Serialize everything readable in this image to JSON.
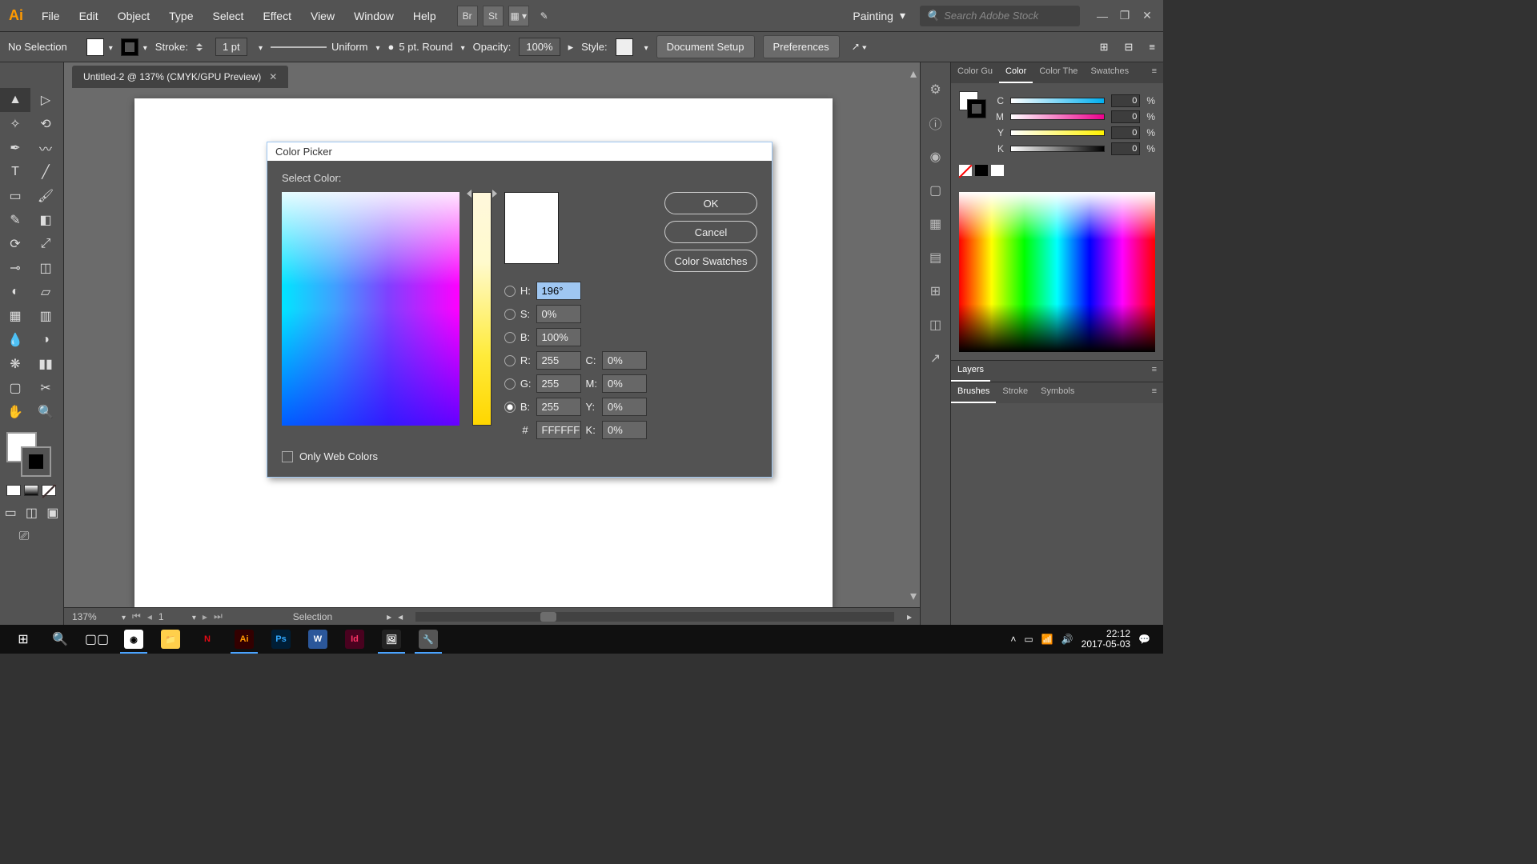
{
  "menu": {
    "items": [
      "File",
      "Edit",
      "Object",
      "Type",
      "Select",
      "Effect",
      "View",
      "Window",
      "Help"
    ],
    "logo": "Ai",
    "bridge": "Br",
    "stock": "St"
  },
  "workspace": {
    "name": "Painting",
    "stock_placeholder": "Search Adobe Stock"
  },
  "options": {
    "status": "No Selection",
    "stroke_label": "Stroke:",
    "stroke_val": "1 pt",
    "profile": "Uniform",
    "profile_val": "5 pt. Round",
    "opacity_label": "Opacity:",
    "opacity_val": "100%",
    "style_label": "Style:",
    "doc_setup": "Document Setup",
    "prefs": "Preferences"
  },
  "document": {
    "tab": "Untitled-2 @ 137% (CMYK/GPU Preview)"
  },
  "dialog": {
    "title": "Color Picker",
    "select": "Select Color:",
    "buttons": {
      "ok": "OK",
      "cancel": "Cancel",
      "swatches": "Color Swatches"
    },
    "H": "H:",
    "S": "S:",
    "B": "B:",
    "R": "R:",
    "G": "G:",
    "Bb": "B:",
    "C": "C:",
    "M": "M:",
    "Y": "Y:",
    "K": "K:",
    "h_val": "196°",
    "s_val": "0%",
    "b_val": "100%",
    "r_val": "255",
    "g_val": "255",
    "bb_val": "255",
    "c_val": "0%",
    "m_val": "0%",
    "y_val": "0%",
    "k_val": "0%",
    "hex": "FFFFFF",
    "only_web": "Only Web Colors"
  },
  "color_panel": {
    "tabs": [
      "Color Gu",
      "Color",
      "Color The",
      "Swatches"
    ],
    "active": 1,
    "cmyk": [
      {
        "l": "C",
        "v": "0"
      },
      {
        "l": "M",
        "v": "0"
      },
      {
        "l": "Y",
        "v": "0"
      },
      {
        "l": "K",
        "v": "0"
      }
    ],
    "pct": "%"
  },
  "layers_panel": {
    "tabs": [
      "Layers"
    ]
  },
  "brushes_panel": {
    "tabs": [
      "Brushes",
      "Stroke",
      "Symbols"
    ]
  },
  "status": {
    "zoom": "137%",
    "artboard": "1",
    "mode": "Selection"
  },
  "taskbar": {
    "time": "22:12",
    "date": "2017-05-03"
  }
}
